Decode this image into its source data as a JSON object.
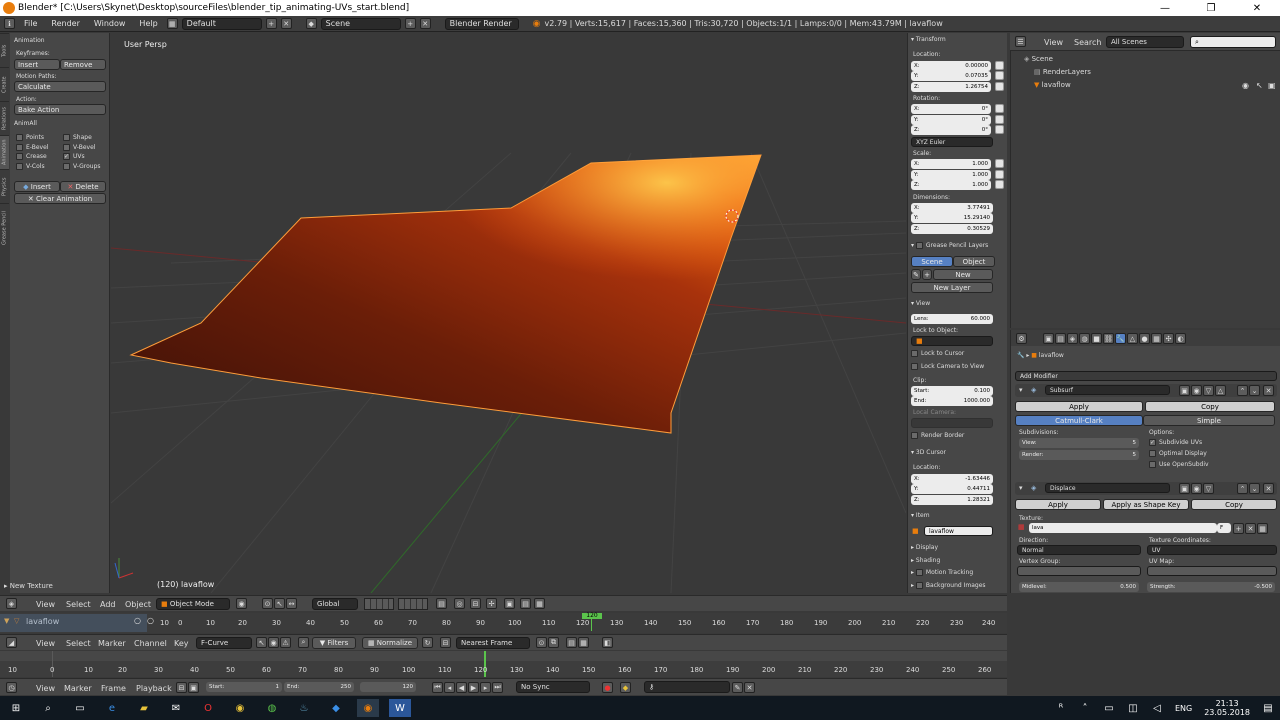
{
  "window": {
    "title": "Blender* [C:\\Users\\Skynet\\Desktop\\sourceFiles\\blender_tip_animating-UVs_start.blend]",
    "min": "—",
    "max": "❐",
    "close": "✕"
  },
  "info": {
    "menus": [
      "File",
      "Render",
      "Window",
      "Help"
    ],
    "layout": "Default",
    "scene": "Scene",
    "engine": "Blender Render",
    "stats": "v2.79 | Verts:15,617 | Faces:15,360 | Tris:30,720 | Objects:1/1 | Lamps:0/0 | Mem:43.79M | lavaflow"
  },
  "toolshelf": {
    "tabs": [
      "Tools",
      "Create",
      "Relations",
      "Animation",
      "Physics",
      "Grease Pencil"
    ],
    "animation_title": "Animation",
    "keyframes_label": "Keyframes:",
    "insert": "Insert",
    "remove": "Remove",
    "motion_paths_label": "Motion Paths:",
    "calculate": "Calculate",
    "action_label": "Action:",
    "bake_action": "Bake Action",
    "animall_title": "AnimAll",
    "checkboxes": [
      "Points",
      "Shape",
      "E-Bevel",
      "V-Bevel",
      "Crease",
      "UVs",
      "V-Cols",
      "V-Groups"
    ],
    "insert2": "Insert",
    "delete": "Delete",
    "clear_animation": "Clear Animation",
    "new_texture": "New Texture"
  },
  "viewport": {
    "label": "User Persp",
    "object_label": "(120) lavaflow"
  },
  "npanel": {
    "transform": "Transform",
    "location": "Location:",
    "loc": [
      [
        "X:",
        "0.00000"
      ],
      [
        "Y:",
        "0.07035"
      ],
      [
        "Z:",
        "1.26754"
      ]
    ],
    "rotation": "Rotation:",
    "rot": [
      [
        "X:",
        "0°"
      ],
      [
        "Y:",
        "0°"
      ],
      [
        "Z:",
        "0°"
      ]
    ],
    "rot_mode": "XYZ Euler",
    "scale": "Scale:",
    "scl": [
      [
        "X:",
        "1.000"
      ],
      [
        "Y:",
        "1.000"
      ],
      [
        "Z:",
        "1.000"
      ]
    ],
    "dimensions": "Dimensions:",
    "dim": [
      [
        "X:",
        "3.77491"
      ],
      [
        "Y:",
        "15.29140"
      ],
      [
        "Z:",
        "0.30529"
      ]
    ],
    "grease_pencil": "Grease Pencil Layers",
    "gp_scene": "Scene",
    "gp_object": "Object",
    "gp_new": "New",
    "gp_new_layer": "New Layer",
    "view": "View",
    "lens": [
      "Lens:",
      "60.000"
    ],
    "lock_to_object": "Lock to Object:",
    "lock_to_cursor": "Lock to Cursor",
    "lock_camera": "Lock Camera to View",
    "clip": "Clip:",
    "clip_start": [
      "Start:",
      "0.100"
    ],
    "clip_end": [
      "End:",
      "1000.000"
    ],
    "local_camera": "Local Camera:",
    "render_border": "Render Border",
    "cursor": "3D Cursor",
    "cursor_location": "Location:",
    "cur": [
      [
        "X:",
        "-1.63446"
      ],
      [
        "Y:",
        "0.44711"
      ],
      [
        "Z:",
        "1.28321"
      ]
    ],
    "item": "Item",
    "item_name": "lavaflow",
    "display": "Display",
    "shading": "Shading",
    "motion_tracking": "Motion Tracking",
    "background_images": "Background Images"
  },
  "outliner": {
    "view": "View",
    "search": "Search",
    "filter": "All Scenes",
    "items": [
      "Scene",
      "RenderLayers",
      "lavaflow"
    ]
  },
  "properties": {
    "object_name": "lavaflow",
    "add_modifier": "Add Modifier",
    "subsurf": "Subsurf",
    "apply": "Apply",
    "copy": "Copy",
    "catmull": "Catmull-Clark",
    "simple": "Simple",
    "subdivisions": "Subdivisions:",
    "view_label": "View:",
    "view_val": "5",
    "render_label": "Render:",
    "render_val": "5",
    "options": "Options:",
    "subdivide_uvs": "Subdivide UVs",
    "optimal_display": "Optimal Display",
    "use_opensubdiv": "Use OpenSubdiv",
    "displace": "Displace",
    "apply2": "Apply",
    "apply_shape": "Apply as Shape Key",
    "copy2": "Copy",
    "texture_label": "Texture:",
    "texture": "lava",
    "texture_f": "F",
    "direction_label": "Direction:",
    "direction": "Normal",
    "texcoords_label": "Texture Coordinates:",
    "texcoords": "UV",
    "vgroup_label": "Vertex Group:",
    "uvmap_label": "UV Map:",
    "midlevel": "Midlevel:",
    "midlevel_val": "0.500",
    "strength": "Strength:",
    "strength_val": "-0.500"
  },
  "view3d_header": {
    "menus": [
      "View",
      "Select",
      "Add",
      "Object"
    ],
    "mode": "Object Mode",
    "orientation": "Global"
  },
  "dopesheet": {
    "object": "lavaflow",
    "ticks": [
      "10",
      "0",
      "10",
      "20",
      "30",
      "40",
      "50",
      "60",
      "70",
      "80",
      "90",
      "100",
      "110",
      "120",
      "130",
      "140",
      "150",
      "160",
      "170",
      "180",
      "190",
      "200",
      "210",
      "220",
      "230",
      "240"
    ],
    "current": "120"
  },
  "graph_header": {
    "menus": [
      "View",
      "Select",
      "Marker",
      "Channel",
      "Key"
    ],
    "mode": "F-Curve",
    "filters": "Filters",
    "normalize": "Normalize",
    "snap": "Nearest Frame"
  },
  "timeline": {
    "ticks": [
      "10",
      "0",
      "10",
      "20",
      "30",
      "40",
      "50",
      "60",
      "70",
      "80",
      "90",
      "100",
      "110",
      "120",
      "130",
      "140",
      "150",
      "160",
      "170",
      "180",
      "190",
      "200",
      "210",
      "220",
      "230",
      "240",
      "250",
      "260"
    ]
  },
  "timeline_header": {
    "menus": [
      "View",
      "Marker",
      "Frame",
      "Playback"
    ],
    "start": [
      "Start:",
      "1"
    ],
    "end": [
      "End:",
      "250"
    ],
    "frame": "120",
    "sync": "No Sync"
  },
  "taskbar": {
    "lang": "ENG",
    "time": "21:13",
    "date": "23.05.2018"
  }
}
